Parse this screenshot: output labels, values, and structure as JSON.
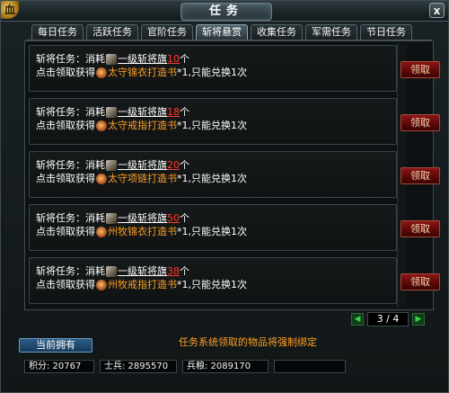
{
  "window": {
    "title": "任务",
    "corner_badge": "血",
    "close_label": "x"
  },
  "tabs": [
    {
      "label": "每日任务",
      "active": false
    },
    {
      "label": "活跃任务",
      "active": false
    },
    {
      "label": "官阶任务",
      "active": false
    },
    {
      "label": "斩将悬赏",
      "active": true
    },
    {
      "label": "收集任务",
      "active": false
    },
    {
      "label": "军需任务",
      "active": false
    },
    {
      "label": "节日任务",
      "active": false
    }
  ],
  "tasks": [
    {
      "prefix": "斩将任务：消耗",
      "item": "一级斩将旗",
      "count": "10",
      "unit": "个",
      "reward_prefix": "点击领取获得",
      "reward": "太守锦衣打造书",
      "reward_suffix": "*1,只能兑换1次",
      "button": "领取"
    },
    {
      "prefix": "斩将任务：消耗",
      "item": "一级斩将旗",
      "count": "18",
      "unit": "个",
      "reward_prefix": "点击领取获得",
      "reward": "太守戒指打造书",
      "reward_suffix": "*1,只能兑换1次",
      "button": "领取"
    },
    {
      "prefix": "斩将任务：消耗",
      "item": "一级斩将旗",
      "count": "20",
      "unit": "个",
      "reward_prefix": "点击领取获得",
      "reward": "太守项链打造书",
      "reward_suffix": "*1,只能兑换1次",
      "button": "领取"
    },
    {
      "prefix": "斩将任务：消耗",
      "item": "一级斩将旗",
      "count": "50",
      "unit": "个",
      "reward_prefix": "点击领取获得",
      "reward": "州牧锦衣打造书",
      "reward_suffix": "*1,只能兑换1次",
      "button": "领取"
    },
    {
      "prefix": "斩将任务：消耗",
      "item": "一级斩将旗",
      "count": "38",
      "unit": "个",
      "reward_prefix": "点击领取获得",
      "reward": "州牧戒指打造书",
      "reward_suffix": "*1,只能兑换1次",
      "button": "领取"
    }
  ],
  "pager": {
    "label": "3 / 4",
    "current": 3,
    "total": 4,
    "prev_icon": "◀",
    "next_icon": "▶"
  },
  "footer": {
    "owned_button": "当前拥有",
    "notice": "任务系统领取的物品将强制绑定",
    "points": "积分: 20767",
    "soldiers": "士兵: 2895570",
    "provisions": "兵粮: 2089170",
    "extra": ""
  }
}
